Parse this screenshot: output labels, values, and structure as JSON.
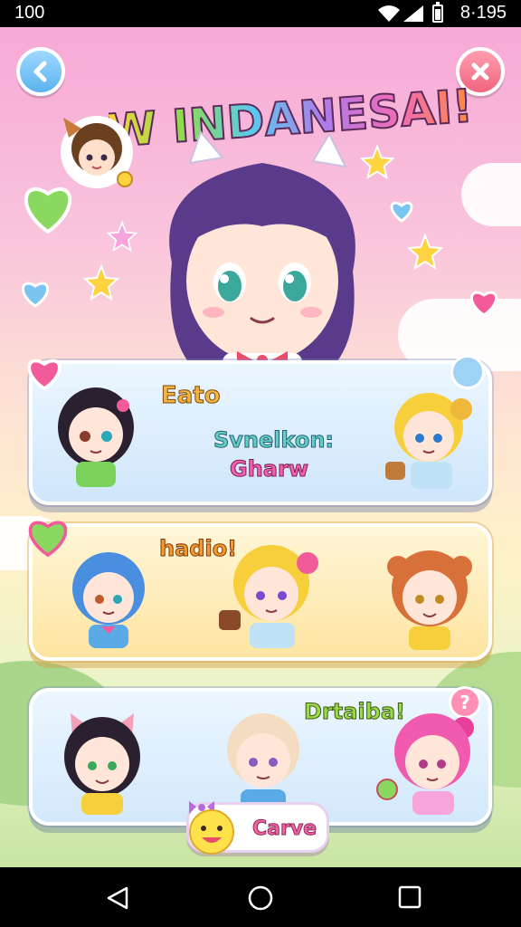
{
  "status_bar": {
    "time": "100",
    "clock": "8·195",
    "icons": [
      "wifi-icon",
      "signal-icon",
      "battery-icon"
    ]
  },
  "game": {
    "title": "W INDANESAI!",
    "back_icon": "chevron-left-icon",
    "close_icon": "close-icon",
    "panels": [
      {
        "heading": "Eato",
        "subtitle_line1": "Svnelkon:",
        "subtitle_line2": "Gharw",
        "badge_icon": "cloud-icon"
      },
      {
        "heading": "hadio!",
        "badge_icon": "heart-icon"
      },
      {
        "heading": "Drtaiba!",
        "badge_icon": "question-icon",
        "badge_text": "?"
      }
    ],
    "action_button": {
      "label": "Carve",
      "icon": "smiley-face-icon"
    }
  },
  "colors": {
    "accent_pink": "#f263a5",
    "accent_blue": "#5ab3ef",
    "accent_red": "#f0637e",
    "panel_blue": "#cfe6fb",
    "panel_yellow": "#fde4a0"
  },
  "nav_bar": {
    "buttons": [
      "back-triangle-icon",
      "home-circle-icon",
      "recents-square-icon"
    ]
  }
}
